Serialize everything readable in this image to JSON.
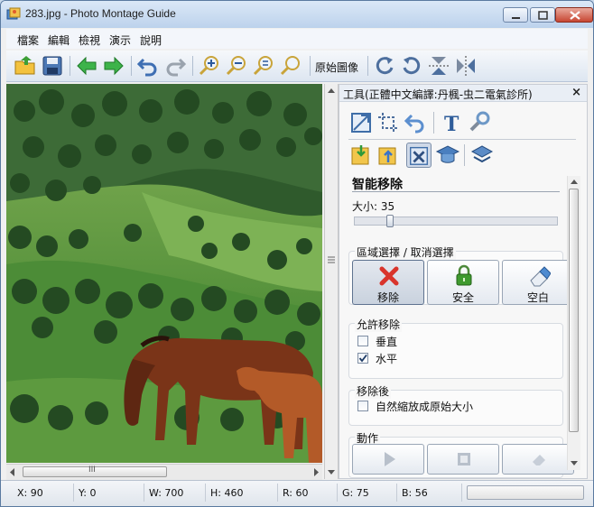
{
  "window": {
    "title": "283.jpg - Photo Montage Guide"
  },
  "menu": [
    "檔案",
    "編輯",
    "檢視",
    "演示",
    "說明"
  ],
  "toolbar": {
    "original_size_label": "原始圖像",
    "icons": [
      "open-folder-icon",
      "save-icon",
      "back-icon",
      "forward-icon",
      "undo-icon",
      "redo-icon",
      "zoom-in-icon",
      "zoom-out-icon",
      "zoom-fit-icon",
      "zoom-actual-icon",
      "rotate-right-icon",
      "rotate-left-icon",
      "flip-vertical-icon",
      "flip-horizontal-icon"
    ]
  },
  "panel": {
    "title": "工具(正體中文編譯:丹楓-虫二電氣診所)",
    "close": "×",
    "section_title": "智能移除",
    "size_label": "大小: 35",
    "size_value": 35,
    "region_group": "區域選擇 / 取消選擇",
    "buttons": {
      "remove": "移除",
      "safe": "安全",
      "blank": "空白"
    },
    "allow_group": "允許移除",
    "vertical": {
      "label": "垂直",
      "checked": false
    },
    "horizontal": {
      "label": "水平",
      "checked": true
    },
    "after_group": "移除後",
    "auto_scale": {
      "label": "自然縮放成原始大小",
      "checked": false
    },
    "action_group": "動作"
  },
  "scroll": {
    "grip": "III"
  },
  "status": {
    "x": "X: 90",
    "y": "Y: 0",
    "w": "W: 700",
    "h": "H: 460",
    "r": "R: 60",
    "g": "G: 75",
    "b": "B: 56"
  },
  "colors": {
    "title_gradient_top": "#dbe8f7",
    "close_button": "#c74632",
    "remove_icon": "#d9342b",
    "safe_icon": "#3f9a2f"
  }
}
